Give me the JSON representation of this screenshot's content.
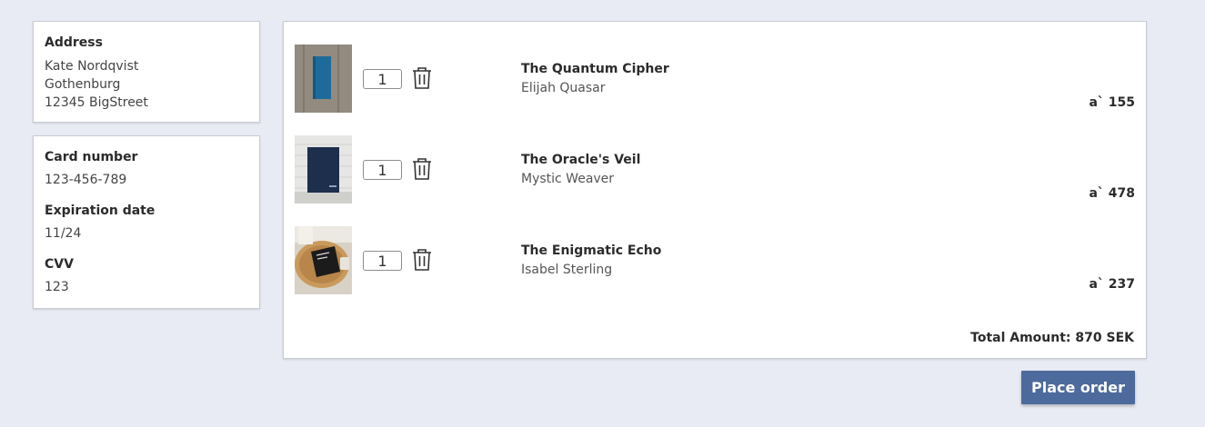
{
  "address": {
    "heading": "Address",
    "lines": [
      "Kate Nordqvist",
      "Gothenburg",
      "12345 BigStreet"
    ]
  },
  "payment": {
    "card_number_label": "Card number",
    "card_number": "123-456-789",
    "expiration_label": "Expiration date",
    "expiration": "11/24",
    "cvv_label": "CVV",
    "cvv": "123"
  },
  "cart": {
    "items": [
      {
        "title": "The Quantum Cipher",
        "author": "Elijah Quasar",
        "price": "a` 155",
        "quantity": "1",
        "thumb": "blue-book-on-wood"
      },
      {
        "title": "The Oracle's Veil",
        "author": "Mystic Weaver",
        "price": "a` 478",
        "quantity": "1",
        "thumb": "navy-book-on-white-wall"
      },
      {
        "title": "The Enigmatic Echo",
        "author": "Isabel Sterling",
        "price": "a` 237",
        "quantity": "1",
        "thumb": "black-book-on-tray"
      }
    ],
    "total": "Total Amount: 870 SEK"
  },
  "actions": {
    "place_order": "Place order"
  },
  "colors": {
    "background": "#e9ebf4",
    "button": "#4d6a9c"
  }
}
